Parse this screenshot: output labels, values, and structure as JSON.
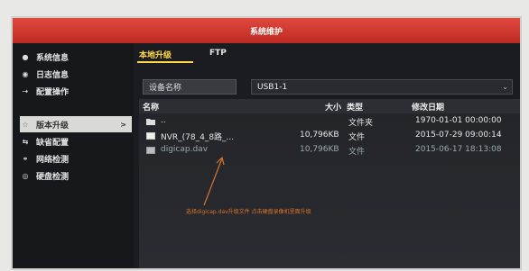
{
  "window": {
    "title": "系统维护"
  },
  "sidebar": {
    "items": [
      {
        "label": "系统信息",
        "icon": "info-dot-icon",
        "active": false
      },
      {
        "label": "日志信息",
        "icon": "log-icon",
        "active": false
      },
      {
        "label": "配置操作",
        "icon": "config-icon",
        "active": false
      },
      {
        "label": "版本升级",
        "icon": "upgrade-icon",
        "active": true
      },
      {
        "label": "缺省配置",
        "icon": "default-icon",
        "active": false
      },
      {
        "label": "网络检测",
        "icon": "network-icon",
        "active": false
      },
      {
        "label": "硬盘检测",
        "icon": "disk-icon",
        "active": false
      }
    ],
    "active_arrow": ">"
  },
  "tabs": {
    "local": "本地升级",
    "ftp": "FTP"
  },
  "device": {
    "label": "设备名称",
    "value": "USB1-1"
  },
  "table": {
    "headers": {
      "name": "名称",
      "size": "大小",
      "type": "类型",
      "date": "修改日期"
    },
    "rows": [
      {
        "name": "..",
        "size": "",
        "type": "文件夹",
        "date": "1970-01-01 00:00:00",
        "icon": "folder-icon"
      },
      {
        "name": "NVR_(78_4_8路_...",
        "size": "10,796KB",
        "type": "文件",
        "date": "2015-07-29 09:00:14",
        "icon": "file-icon"
      },
      {
        "name": "digicap.dav",
        "size": "10,796KB",
        "type": "文件",
        "date": "2015-06-17 18:13:08",
        "icon": "file-icon"
      }
    ]
  },
  "annotation": {
    "text": "选择digicap.dav升级文件 点击硬盘录像机里面升级",
    "color": "#d8742a"
  }
}
